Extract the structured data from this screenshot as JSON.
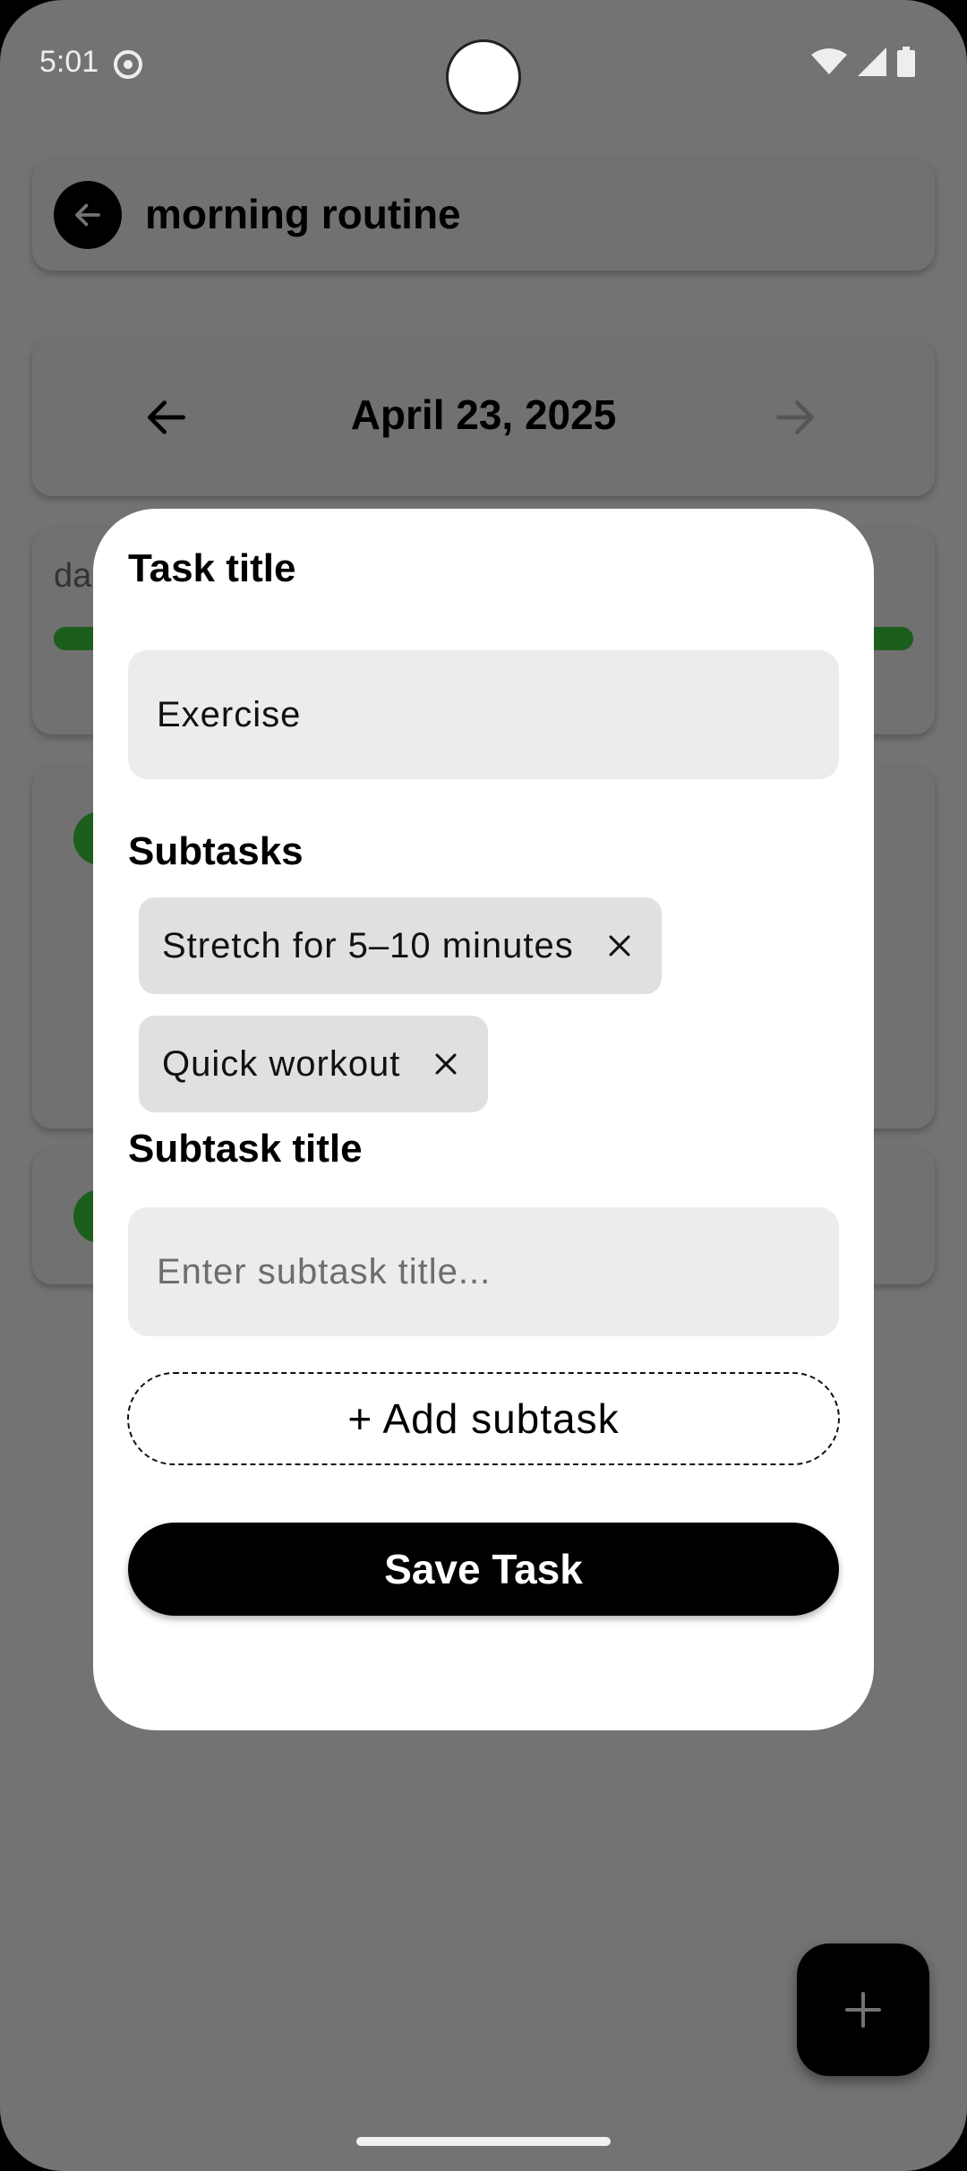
{
  "status_bar": {
    "time": "5:01"
  },
  "header": {
    "title": "morning routine"
  },
  "date_nav": {
    "date": "April 23, 2025"
  },
  "progress": {
    "label": "da",
    "fill_percent": 100,
    "fill_color": "#1c5e1c"
  },
  "dialog": {
    "task_title_label": "Task title",
    "task_title_value": "Exercise",
    "subtasks_label": "Subtasks",
    "subtasks": [
      {
        "label": "Stretch for 5–10 minutes"
      },
      {
        "label": "Quick workout"
      }
    ],
    "subtask_title_label": "Subtask title",
    "subtask_title_placeholder": "Enter subtask title...",
    "add_subtask_label": "+ Add subtask",
    "save_label": "Save Task"
  },
  "icons": {
    "back": "arrow-left-icon",
    "prev": "arrow-left-icon",
    "next": "arrow-right-icon",
    "remove": "close-icon",
    "fab": "plus-icon"
  },
  "colors": {
    "scrim": "#737373",
    "accent": "#000000",
    "success": "#1c5e1c"
  }
}
